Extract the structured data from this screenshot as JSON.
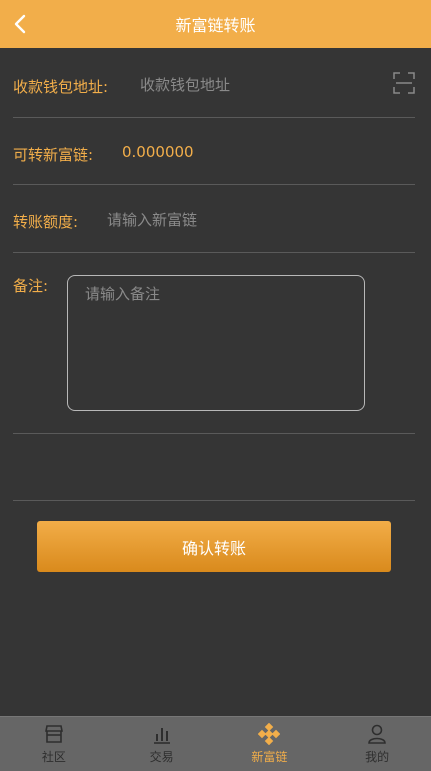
{
  "header": {
    "title": "新富链转账"
  },
  "form": {
    "address_label": "收款钱包地址:",
    "address_placeholder": "收款钱包地址",
    "balance_label": "可转新富链:",
    "balance_value": "0.000000",
    "amount_label": "转账额度:",
    "amount_placeholder": "请输入新富链",
    "memo_label": "备注:",
    "memo_placeholder": "请输入备注"
  },
  "confirm_label": "确认转账",
  "tabs": [
    {
      "label": "社区",
      "icon": "store-icon"
    },
    {
      "label": "交易",
      "icon": "bar-chart-icon"
    },
    {
      "label": "新富链",
      "icon": "chain-knot-icon"
    },
    {
      "label": "我的",
      "icon": "user-icon"
    }
  ],
  "colors": {
    "accent": "#f2ae4a",
    "background": "#353535",
    "tabbar": "#666666"
  }
}
